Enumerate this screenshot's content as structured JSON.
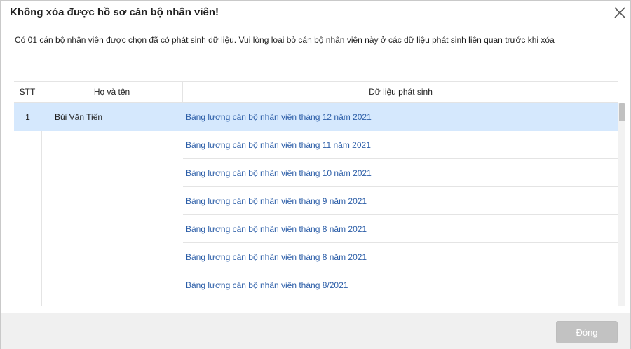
{
  "dialog": {
    "title": "Không xóa được hồ sơ cán bộ nhân viên!",
    "message": "Có 01 cán bộ nhân viên được chọn đã có phát sinh dữ liệu. Vui lòng loại bỏ cán bộ nhân viên này ở các dữ liệu phát sinh liên quan trước khi xóa",
    "close_icon": "close-icon"
  },
  "table": {
    "headers": {
      "stt": "STT",
      "name": "Họ và tên",
      "data": "Dữ liệu phát sinh"
    },
    "employee": {
      "stt": "1",
      "name": "Bùi Văn Tiến"
    },
    "rows": [
      "Bảng lương cán bộ nhân viên tháng 12 năm 2021",
      "Bảng lương cán bộ nhân viên tháng 11 năm 2021",
      "Bảng lương cán bộ nhân viên tháng 10 năm 2021",
      "Bảng lương cán bộ nhân viên tháng 9 năm 2021",
      "Bảng lương cán bộ nhân viên tháng 8 năm 2021",
      "Bảng lương cán bộ nhân viên tháng 8 năm 2021",
      "Bảng lương cán bộ nhân viên tháng 8/2021"
    ]
  },
  "footer": {
    "close_label": "Đóng"
  },
  "colors": {
    "selected_row": "#d5e8fd",
    "link_text": "#2c5ea8",
    "button_disabled": "#c2c2c2"
  }
}
